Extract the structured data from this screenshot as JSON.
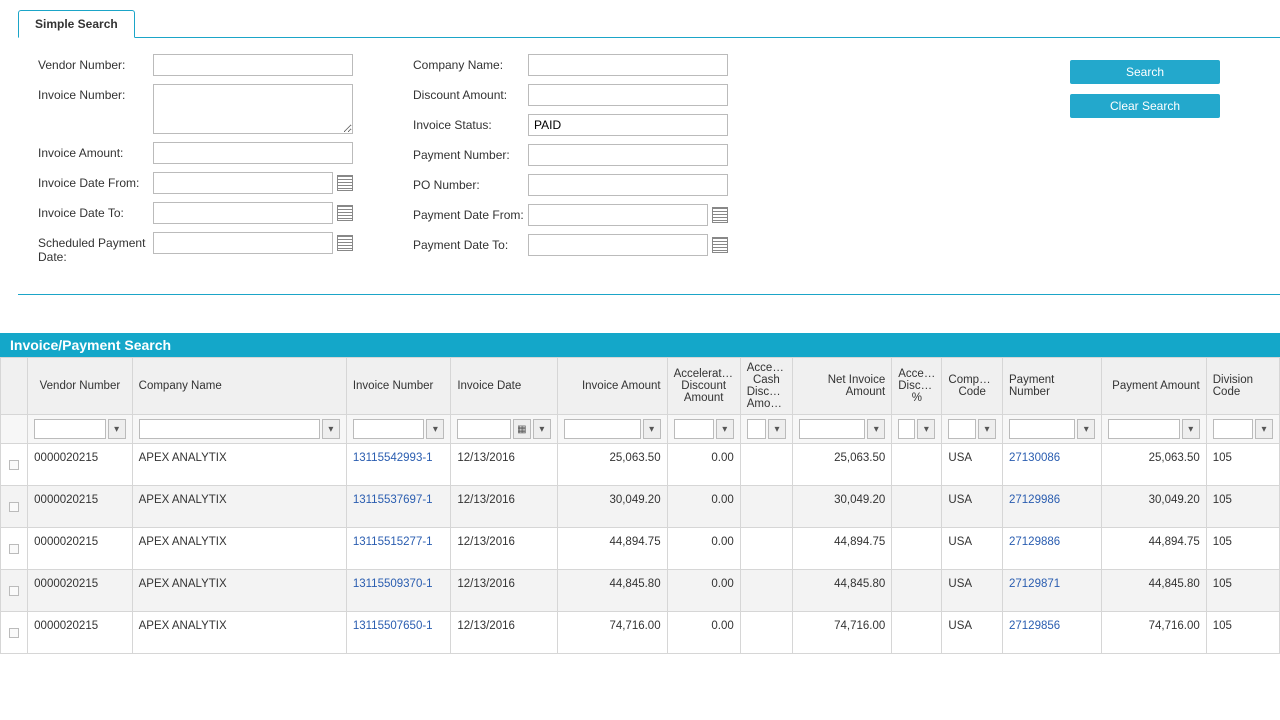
{
  "tab": {
    "label": "Simple Search"
  },
  "form": {
    "left": {
      "vendor_number": "Vendor Number:",
      "invoice_number": "Invoice Number:",
      "invoice_amount": "Invoice Amount:",
      "invoice_date_from": "Invoice Date From:",
      "invoice_date_to": "Invoice Date To:",
      "scheduled_payment_date": "Scheduled Payment Date:"
    },
    "right": {
      "company_name": "Company Name:",
      "discount_amount": "Discount Amount:",
      "invoice_status": "Invoice Status:",
      "invoice_status_value": "PAID",
      "payment_number": "Payment Number:",
      "po_number": "PO Number:",
      "payment_date_from": "Payment Date From:",
      "payment_date_to": "Payment Date To:"
    },
    "buttons": {
      "search": "Search",
      "clear": "Clear Search"
    }
  },
  "grid": {
    "title": "Invoice/Payment Search",
    "columns": [
      "",
      "Vendor Number",
      "Company Name",
      "Invoice Number",
      "Invoice Date",
      "Invoice Amount",
      "Accelerated Discount Amount",
      "Accelerated Cash Discount Amount",
      "Net Invoice Amount",
      "Accelerated Discount %",
      "Company Code",
      "Payment Number",
      "Payment Amount",
      "Division Code"
    ],
    "rows": [
      {
        "vendor": "0000020215",
        "company": "APEX ANALYTIX",
        "invnum": "13115542993-1",
        "invdate": "12/13/2016",
        "invamt": "25,063.50",
        "adisc": "0.00",
        "acash": "",
        "net": "25,063.50",
        "adpc": "",
        "cc": "USA",
        "pnum": "27130086",
        "pamt": "25,063.50",
        "div": "105"
      },
      {
        "vendor": "0000020215",
        "company": "APEX ANALYTIX",
        "invnum": "13115537697-1",
        "invdate": "12/13/2016",
        "invamt": "30,049.20",
        "adisc": "0.00",
        "acash": "",
        "net": "30,049.20",
        "adpc": "",
        "cc": "USA",
        "pnum": "27129986",
        "pamt": "30,049.20",
        "div": "105"
      },
      {
        "vendor": "0000020215",
        "company": "APEX ANALYTIX",
        "invnum": "13115515277-1",
        "invdate": "12/13/2016",
        "invamt": "44,894.75",
        "adisc": "0.00",
        "acash": "",
        "net": "44,894.75",
        "adpc": "",
        "cc": "USA",
        "pnum": "27129886",
        "pamt": "44,894.75",
        "div": "105"
      },
      {
        "vendor": "0000020215",
        "company": "APEX ANALYTIX",
        "invnum": "13115509370-1",
        "invdate": "12/13/2016",
        "invamt": "44,845.80",
        "adisc": "0.00",
        "acash": "",
        "net": "44,845.80",
        "adpc": "",
        "cc": "USA",
        "pnum": "27129871",
        "pamt": "44,845.80",
        "div": "105"
      },
      {
        "vendor": "0000020215",
        "company": "APEX ANALYTIX",
        "invnum": "13115507650-1",
        "invdate": "12/13/2016",
        "invamt": "74,716.00",
        "adisc": "0.00",
        "acash": "",
        "net": "74,716.00",
        "adpc": "",
        "cc": "USA",
        "pnum": "27129856",
        "pamt": "74,716.00",
        "div": "105"
      }
    ]
  }
}
